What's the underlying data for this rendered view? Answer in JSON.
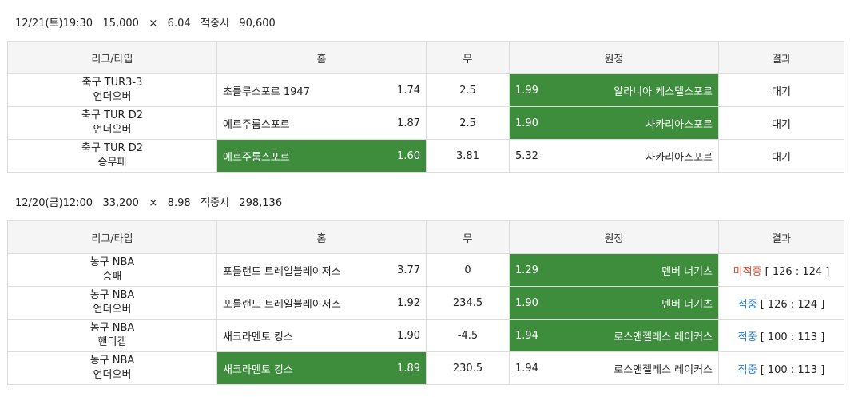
{
  "slips": [
    {
      "header": {
        "date": "12/21(토)19:30",
        "stake": "15,000",
        "times": "×",
        "odds": "6.04",
        "win_label": "적중시",
        "payout": "90,600"
      },
      "columns": [
        "리그/타입",
        "홈",
        "무",
        "원정",
        "결과"
      ],
      "rows": [
        {
          "league": "축구 TUR3-3",
          "type": "언더오버",
          "home": "초를루스포르 1947",
          "home_odds": "1.74",
          "draw": "2.5",
          "away_odds": "1.99",
          "away": "알라니아 케스텔스포르",
          "pick": "away",
          "result_status": "대기",
          "result_score": ""
        },
        {
          "league": "축구 TUR D2",
          "type": "언더오버",
          "home": "에르주룸스포르",
          "home_odds": "1.87",
          "draw": "2.5",
          "away_odds": "1.90",
          "away": "사카리아스포르",
          "pick": "away",
          "result_status": "대기",
          "result_score": ""
        },
        {
          "league": "축구 TUR D2",
          "type": "승무패",
          "home": "에르주룸스포르",
          "home_odds": "1.60",
          "draw": "3.81",
          "away_odds": "5.32",
          "away": "사카리아스포르",
          "pick": "home",
          "result_status": "대기",
          "result_score": ""
        }
      ]
    },
    {
      "header": {
        "date": "12/20(금)12:00",
        "stake": "33,200",
        "times": "×",
        "odds": "8.98",
        "win_label": "적중시",
        "payout": "298,136"
      },
      "columns": [
        "리그/타입",
        "홈",
        "무",
        "원정",
        "결과"
      ],
      "rows": [
        {
          "league": "농구 NBA",
          "type": "승패",
          "home": "포틀랜드 트레일블레이저스",
          "home_odds": "3.77",
          "draw": "0",
          "away_odds": "1.29",
          "away": "덴버 너기츠",
          "pick": "away",
          "result_status": "미적중",
          "result_score": "[ 126 : 124 ]"
        },
        {
          "league": "농구 NBA",
          "type": "언더오버",
          "home": "포틀랜드 트레일블레이저스",
          "home_odds": "1.92",
          "draw": "234.5",
          "away_odds": "1.90",
          "away": "덴버 너기츠",
          "pick": "away",
          "result_status": "적중",
          "result_score": "[ 126 : 124 ]"
        },
        {
          "league": "농구 NBA",
          "type": "핸디캡",
          "home": "새크라멘토 킹스",
          "home_odds": "1.90",
          "draw": "-4.5",
          "away_odds": "1.94",
          "away": "로스앤젤레스 레이커스",
          "pick": "away",
          "result_status": "적중",
          "result_score": "[ 100 : 113 ]"
        },
        {
          "league": "농구 NBA",
          "type": "언더오버",
          "home": "새크라멘토 킹스",
          "home_odds": "1.89",
          "draw": "230.5",
          "away_odds": "1.94",
          "away": "로스앤젤레스 레이커스",
          "pick": "home",
          "result_status": "적중",
          "result_score": "[ 100 : 113 ]"
        }
      ]
    }
  ],
  "colors": {
    "selected": "#3d8d3d",
    "miss": "#e8462b",
    "hit": "#1f7bd6",
    "pending": "#888888"
  }
}
